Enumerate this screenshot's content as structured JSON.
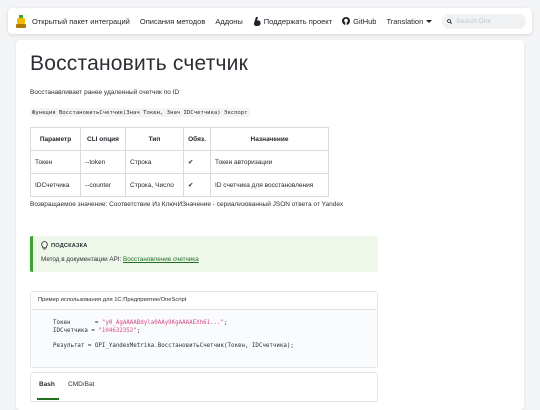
{
  "nav": {
    "items": [
      {
        "label": "Открытый пакет интеграций"
      },
      {
        "label": "Описания методов"
      },
      {
        "label": "Аддоны"
      },
      {
        "label": "Поддержать проект"
      },
      {
        "label": "GitHub"
      },
      {
        "label": "Translation"
      }
    ],
    "search_placeholder": "Search OInt"
  },
  "page": {
    "title": "Восстановить счетчик",
    "description": "Восстанавливает ранее удаленный счетчик по ID",
    "signature": "Функция ВосстановитьСчетчик(Знач Токен, Знач IDСчетчика) Экспорт",
    "return_text": "Возвращаемое значение: Соответствие Из КлючИЗначение - сериализованный JSON ответа от Yandex"
  },
  "params_table": {
    "headers": [
      "Параметр",
      "CLI опция",
      "Тип",
      "Обяз.",
      "Назначение"
    ],
    "rows": [
      [
        "Токен",
        "--token",
        "Строка",
        "✔",
        "Токен авторизации"
      ],
      [
        "IDСчетчика",
        "--counter",
        "Строка, Число",
        "✔",
        "ID счетчика для восстановления"
      ]
    ]
  },
  "tip": {
    "title": "ПОДСКАЗКА",
    "text": "Метод в документации API: ",
    "link": "Восстановление счетчика"
  },
  "example": {
    "header": "Пример использования для 1С:Предприятие/OneScript",
    "line1_var": "Токен       = ",
    "line1_val": "\"y0_AgAAAABdyla0AAy9KgAAAAEXh61...\"",
    "line1_end": ";",
    "line2_var": "IDСчетчика = ",
    "line2_val": "\"104632352\"",
    "line2_end": ";",
    "line3": "Результат = OPI_YandexMetrika.ВосстановитьСчетчик(Токен, IDСчетчика);"
  },
  "tabs": [
    {
      "label": "Bash"
    },
    {
      "label": "CMD/Bat"
    }
  ],
  "colors": {
    "accent_green": "#3aa62f",
    "link_green": "#1f6f1f",
    "string_pink": "#d14a8b"
  }
}
